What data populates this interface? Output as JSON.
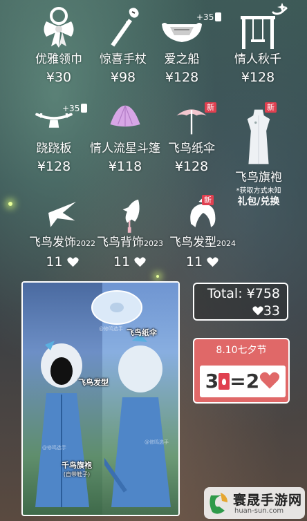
{
  "items": [
    {
      "name": "优雅领巾",
      "price": "¥30",
      "icon": "bow-tie-icon"
    },
    {
      "name": "惊喜手杖",
      "price": "¥98",
      "icon": "wand-icon"
    },
    {
      "name": "爱之船",
      "price": "¥128",
      "icon": "boat-icon"
    },
    {
      "name": "情人秋千",
      "price": "¥128",
      "icon": "swing-icon"
    },
    {
      "name": "跷跷板",
      "price": "¥128",
      "icon": "seesaw-icon"
    },
    {
      "name": "情人流星斗篷",
      "price": "¥118",
      "icon": "cape-icon"
    },
    {
      "name": "飞鸟纸伞",
      "price": "¥128",
      "icon": "umbrella-icon"
    },
    {
      "name": "飞鸟旗袍",
      "note": "*获取方式未知",
      "sub": "礼包/兑换",
      "icon": "qipao-icon"
    },
    {
      "name": "飞鸟发饰",
      "year": "2022",
      "price": "11",
      "icon": "bird-hairpin-icon"
    },
    {
      "name": "飞鸟背饰",
      "year": "2023",
      "price": "11",
      "icon": "bird-back-icon"
    },
    {
      "name": "飞鸟发型",
      "year": "2024",
      "price": "11",
      "icon": "bird-hairstyle-icon"
    }
  ],
  "badges": {
    "boat_plus": "+35",
    "seesaw_plus": "+35",
    "new": "新"
  },
  "preview": {
    "tag_umbrella": "飞鸟纸伞",
    "tag_hairstyle": "飞鸟发型",
    "tag_qipao": "千鸟旗袍",
    "tag_qipao_sub": "(自带鞋子)",
    "watermark": "@修鸣选手"
  },
  "summary": {
    "total_label": "Total: ¥758",
    "hearts": "33"
  },
  "festival": {
    "title": "8.10七夕节",
    "lhs": "3",
    "eq": "=",
    "rhs": "2"
  },
  "site": {
    "brand": "寰晟手游网",
    "url": "huan-sun.com"
  },
  "colors": {
    "heart": "#ffffff",
    "festival_bg": "#e06868",
    "new_badge": "#e04050"
  }
}
